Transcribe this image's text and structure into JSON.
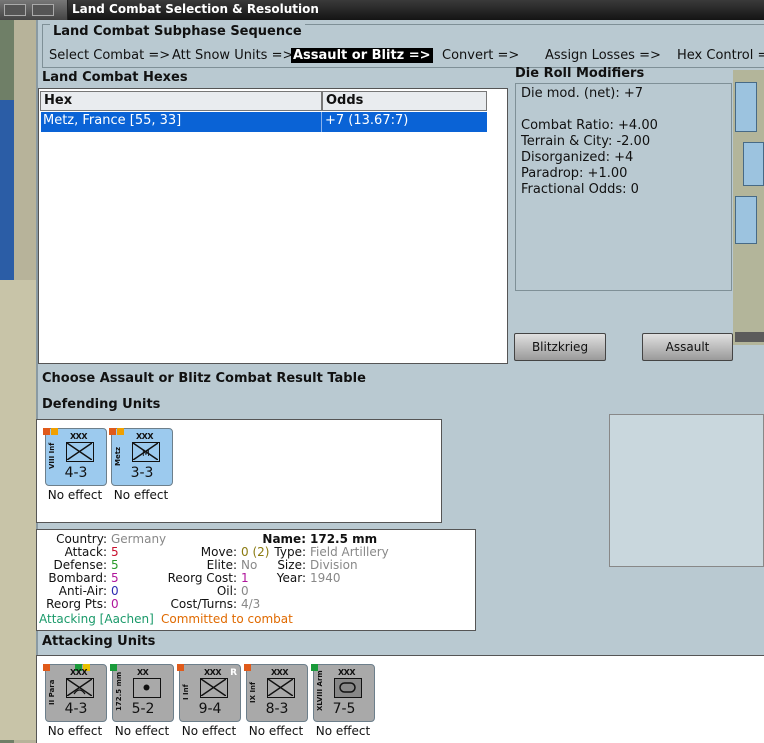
{
  "window": {
    "title": "Land Combat Selection & Resolution"
  },
  "subphase": {
    "title": "Land Combat Subphase Sequence",
    "steps": [
      {
        "label": "Select Combat =>",
        "active": false
      },
      {
        "label": "Att Snow Units =>",
        "active": false
      },
      {
        "label": "Assault or Blitz =>",
        "active": true
      },
      {
        "label": "Convert =>",
        "active": false
      },
      {
        "label": "Assign Losses =>",
        "active": false
      },
      {
        "label": "Hex Control =>",
        "active": false
      }
    ]
  },
  "hexes": {
    "title": "Land Combat Hexes",
    "columns": [
      "Hex",
      "Odds"
    ],
    "rows": [
      {
        "hex": "Metz, France [55, 33]",
        "odds": "+7 (13.67:7)"
      }
    ]
  },
  "modifiers": {
    "title": "Die Roll Modifiers",
    "net": "Die mod. (net): +7",
    "lines": [
      "Combat Ratio: +4.00",
      "Terrain & City: -2.00",
      "Disorganized: +4",
      "Paradrop: +1.00",
      "Fractional Odds: 0"
    ]
  },
  "buttons": {
    "blitzkrieg": "Blitzkrieg",
    "assault": "Assault"
  },
  "prompt": "Choose Assault or Blitz Combat Result Table",
  "defending": {
    "title": "Defending Units",
    "units": [
      {
        "name": "VIII Inf",
        "size": "XXX",
        "strength": "4-3",
        "result": "No effect"
      },
      {
        "name": "Metz",
        "size": "XXX",
        "strength": "3-3",
        "result": "No effect"
      }
    ]
  },
  "unit_info": {
    "country_label": "Country:",
    "country": "Germany",
    "attack_label": "Attack:",
    "attack": "5",
    "defense_label": "Defense:",
    "defense": "5",
    "bombard_label": "Bombard:",
    "bombard": "5",
    "antiair_label": "Anti-Air:",
    "antiair": "0",
    "reorg_pts_label": "Reorg Pts:",
    "reorg_pts": "0",
    "move_label": "Move:",
    "move": "0 (2)",
    "elite_label": "Elite:",
    "elite": "No",
    "reorg_cost_label": "Reorg Cost:",
    "reorg_cost": "1",
    "oil_label": "Oil:",
    "oil": "0",
    "cost_turns_label": "Cost/Turns:",
    "cost_turns": "4/3",
    "name_label": "Name:",
    "name": "172.5 mm",
    "type_label": "Type:",
    "type": "Field Artillery",
    "size_label": "Size:",
    "size": "Division",
    "year_label": "Year:",
    "year": "1940",
    "attacking": "Attacking [Aachen]",
    "committed": "Committed to combat"
  },
  "attacking": {
    "title": "Attacking Units",
    "units": [
      {
        "name": "II Para",
        "size": "XXX",
        "strength": "4-3",
        "result": "No effect"
      },
      {
        "name": "172.5 mm",
        "size": "XX",
        "strength": "5-2",
        "result": "No effect"
      },
      {
        "name": "I Inf",
        "size": "XXX",
        "strength": "9-4",
        "flag": "R",
        "result": "No effect"
      },
      {
        "name": "IX Inf",
        "size": "XXX",
        "strength": "8-3",
        "result": "No effect"
      },
      {
        "name": "XLVIII Arm",
        "size": "XXX",
        "strength": "7-5",
        "result": "No effect"
      }
    ]
  },
  "colors": {
    "selected_row": "#0a63d6",
    "defender_counter": "#9ccaee",
    "attacker_counter": "#a9a9a9",
    "value_red": "#c8102e",
    "value_green": "#2a9a2a",
    "value_magenta": "#b0169c",
    "value_blue": "#2a2ab0",
    "value_olive": "#8a7a10",
    "value_gray": "#888888",
    "attacking_text": "#1a9a6a",
    "committed_text": "#e06a00"
  }
}
